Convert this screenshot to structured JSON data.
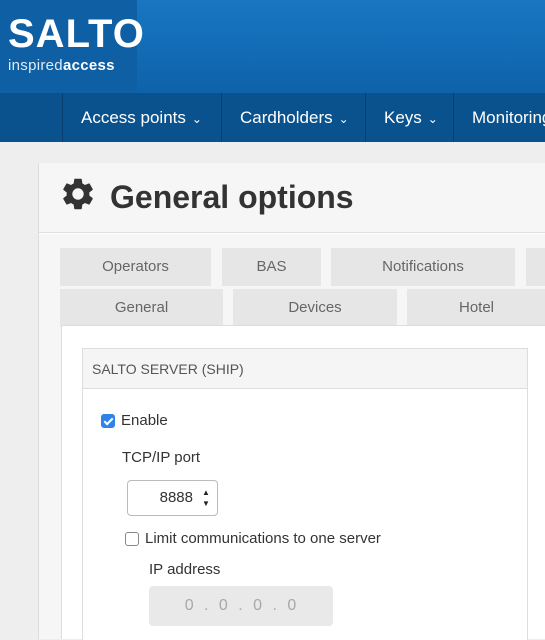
{
  "brand": {
    "name": "SALTO",
    "tagline_light": "inspired",
    "tagline_bold": "access"
  },
  "nav": {
    "items": [
      {
        "label": "Access points"
      },
      {
        "label": "Cardholders"
      },
      {
        "label": "Keys"
      },
      {
        "label": "Monitoring"
      }
    ],
    "chevron": "⌄"
  },
  "page": {
    "title": "General options",
    "title_icon": "gear-icon"
  },
  "tabs": {
    "row1": [
      "Operators",
      "BAS",
      "Notifications"
    ],
    "row2": [
      "General",
      "Devices",
      "Hotel"
    ],
    "active": "General"
  },
  "server_section": {
    "heading": "SALTO SERVER (SHIP)",
    "enable_label": "Enable",
    "enable_checked": true,
    "port_label": "TCP/IP port",
    "port_value": "8888",
    "limit_label": "Limit communications to one server",
    "limit_checked": false,
    "ip_label": "IP address",
    "ip_value": "0 . 0 . 0 . 0"
  },
  "colors": {
    "header_blue": "#1976c2",
    "nav_blue": "#0a528d",
    "checkbox_blue": "#2f83e8"
  }
}
